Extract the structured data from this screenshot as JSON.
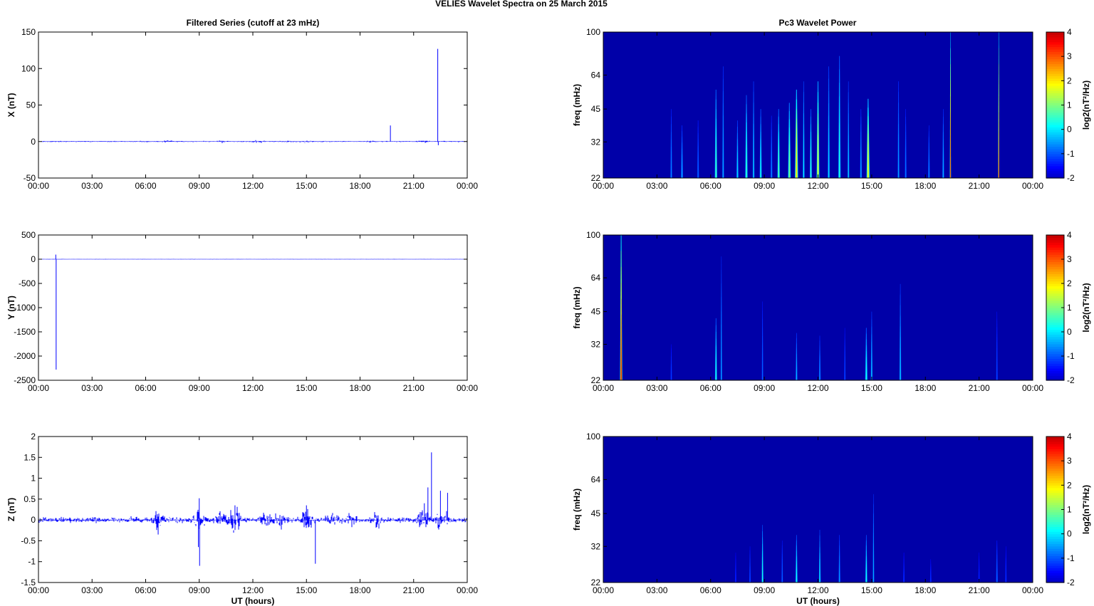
{
  "figure": {
    "suptitle": "VELIES Wavelet Spectra on 25 March     2015",
    "left_title": "Filtered Series (cutoff at 23 mHz)",
    "right_title": "Pc3 Wavelet Power"
  },
  "colors": {
    "series": "#0000ff",
    "axis": "#000000",
    "spec_bg": "#00008f"
  },
  "chart_data": [
    {
      "type": "line",
      "panel": "X",
      "ylabel": "X (nT)",
      "xlabel": "",
      "xticks": [
        "00:00",
        "03:00",
        "06:00",
        "09:00",
        "12:00",
        "15:00",
        "18:00",
        "21:00",
        "00:00"
      ],
      "xlim": [
        0,
        24
      ],
      "ylim": [
        -50,
        150
      ],
      "yticks": [
        -50,
        0,
        50,
        100,
        150
      ],
      "noise": 0.6,
      "bursts": [
        [
          4.0,
          0.3
        ],
        [
          7.2,
          0.6
        ],
        [
          10.2,
          0.8
        ],
        [
          12.3,
          1.0
        ],
        [
          14.0,
          0.7
        ],
        [
          15.0,
          0.8
        ],
        [
          18.5,
          0.6
        ],
        [
          21.6,
          0.9
        ]
      ],
      "spikes": [
        [
          19.7,
          22
        ],
        [
          22.35,
          127
        ],
        [
          22.38,
          -5
        ]
      ],
      "grid": false
    },
    {
      "type": "line",
      "panel": "Y",
      "ylabel": "Y (nT)",
      "xlabel": "",
      "xticks": [
        "00:00",
        "03:00",
        "06:00",
        "09:00",
        "12:00",
        "15:00",
        "18:00",
        "21:00",
        "00:00"
      ],
      "xlim": [
        0,
        24
      ],
      "ylim": [
        -2500,
        500
      ],
      "yticks": [
        -2500,
        -2000,
        -1500,
        -1000,
        -500,
        0,
        500
      ],
      "noise": 2,
      "bursts": [],
      "spikes": [
        [
          0.97,
          95
        ],
        [
          0.99,
          -2280
        ]
      ],
      "grid": false
    },
    {
      "type": "line",
      "panel": "Z",
      "ylabel": "Z (nT)",
      "xlabel": "UT (hours)",
      "xticks": [
        "00:00",
        "03:00",
        "06:00",
        "09:00",
        "12:00",
        "15:00",
        "18:00",
        "21:00",
        "00:00"
      ],
      "xlim": [
        0,
        24
      ],
      "ylim": [
        -1.5,
        2
      ],
      "yticks": [
        -1.5,
        -1,
        -0.5,
        0,
        0.5,
        1,
        1.5,
        2
      ],
      "yticklabels": [
        "-1.5",
        "-1",
        "-0.5",
        "0",
        "0.5",
        "1",
        "1.5",
        "2"
      ],
      "noise": 0.05,
      "bursts": [
        [
          6.7,
          0.13
        ],
        [
          9.0,
          0.2
        ],
        [
          10.2,
          0.15
        ],
        [
          11.0,
          0.25
        ],
        [
          12.8,
          0.15
        ],
        [
          13.6,
          0.13
        ],
        [
          15.0,
          0.22
        ],
        [
          16.5,
          0.12
        ],
        [
          17.5,
          0.1
        ],
        [
          19.0,
          0.12
        ],
        [
          21.5,
          0.2
        ],
        [
          22.6,
          0.2
        ]
      ],
      "spikes": [
        [
          9.0,
          0.52
        ],
        [
          9.02,
          -1.1
        ],
        [
          11.0,
          0.35
        ],
        [
          15.0,
          0.35
        ],
        [
          15.5,
          -1.05
        ],
        [
          21.6,
          0.4
        ],
        [
          21.8,
          0.78
        ],
        [
          22.0,
          1.62
        ],
        [
          22.5,
          0.7
        ],
        [
          22.9,
          0.65
        ],
        [
          8.95,
          -0.65
        ],
        [
          6.7,
          -0.35
        ]
      ],
      "grid": false
    },
    {
      "type": "heatmap",
      "panel": "X",
      "ylabel": "freq (mHz)",
      "xlabel": "",
      "colorbar_label": "log2(nT²/Hz)",
      "yscale": "log",
      "ylim": [
        22,
        100
      ],
      "yticks": [
        22,
        32,
        45,
        64,
        100
      ],
      "xlim": [
        0,
        24
      ],
      "xticks": [
        "00:00",
        "03:00",
        "06:00",
        "09:00",
        "12:00",
        "15:00",
        "18:00",
        "21:00",
        "00:00"
      ],
      "clim": [
        -2,
        4
      ],
      "cticks": [
        -2,
        -1,
        0,
        1,
        2,
        3,
        4
      ],
      "background_level": -2,
      "features": [
        [
          3.8,
          45,
          -0.8,
          0.05
        ],
        [
          4.4,
          38,
          -0.6,
          0.06
        ],
        [
          5.3,
          40,
          -1.0,
          0.05
        ],
        [
          6.3,
          55,
          0.6,
          0.07
        ],
        [
          6.7,
          70,
          -0.5,
          0.05
        ],
        [
          7.5,
          40,
          -0.2,
          0.06
        ],
        [
          8.0,
          52,
          0.5,
          0.07
        ],
        [
          8.4,
          60,
          -0.2,
          0.05
        ],
        [
          8.8,
          45,
          0.2,
          0.06
        ],
        [
          9.4,
          42,
          -0.8,
          0.05
        ],
        [
          9.8,
          45,
          0.7,
          0.07
        ],
        [
          10.4,
          48,
          1.0,
          0.08
        ],
        [
          10.8,
          55,
          2.2,
          0.09
        ],
        [
          11.2,
          60,
          0.0,
          0.05
        ],
        [
          11.6,
          45,
          0.5,
          0.06
        ],
        [
          12.0,
          60,
          1.8,
          0.08
        ],
        [
          12.6,
          70,
          -0.2,
          0.06
        ],
        [
          13.2,
          78,
          0.3,
          0.07
        ],
        [
          13.7,
          60,
          -0.3,
          0.05
        ],
        [
          14.4,
          45,
          -0.5,
          0.05
        ],
        [
          14.8,
          50,
          2.0,
          0.09
        ],
        [
          16.5,
          60,
          -0.6,
          0.05
        ],
        [
          16.9,
          45,
          -0.9,
          0.05
        ],
        [
          18.2,
          38,
          -0.8,
          0.05
        ],
        [
          19.0,
          45,
          -0.5,
          0.05
        ],
        [
          19.4,
          100,
          3.5,
          0.03
        ],
        [
          22.1,
          100,
          3.8,
          0.03
        ]
      ]
    },
    {
      "type": "heatmap",
      "panel": "Y",
      "ylabel": "freq (mHz)",
      "xlabel": "",
      "colorbar_label": "log2(nT²/Hz)",
      "yscale": "log",
      "ylim": [
        22,
        100
      ],
      "yticks": [
        22,
        32,
        45,
        64,
        100
      ],
      "xlim": [
        0,
        24
      ],
      "xticks": [
        "00:00",
        "03:00",
        "06:00",
        "09:00",
        "12:00",
        "15:00",
        "18:00",
        "21:00",
        "00:00"
      ],
      "clim": [
        -2,
        4
      ],
      "cticks": [
        -2,
        -1,
        0,
        1,
        2,
        3,
        4
      ],
      "background_level": -2,
      "features": [
        [
          1.0,
          100,
          4.0,
          0.06
        ],
        [
          3.8,
          32,
          -1.3,
          0.04
        ],
        [
          6.3,
          42,
          0.3,
          0.06
        ],
        [
          6.6,
          80,
          -0.5,
          0.04
        ],
        [
          8.9,
          50,
          -1.0,
          0.04
        ],
        [
          10.8,
          36,
          -0.4,
          0.05
        ],
        [
          12.1,
          35,
          -0.7,
          0.05
        ],
        [
          13.5,
          38,
          -1.2,
          0.04
        ],
        [
          14.7,
          38,
          0.2,
          0.07
        ],
        [
          15.0,
          45,
          -0.3,
          0.05
        ],
        [
          16.6,
          60,
          -0.3,
          0.05
        ],
        [
          22.0,
          45,
          -1.2,
          0.04
        ]
      ]
    },
    {
      "type": "heatmap",
      "panel": "Z",
      "ylabel": "freq (mHz)",
      "xlabel": "UT (hours)",
      "colorbar_label": "log2(nT²/Hz)",
      "yscale": "log",
      "ylim": [
        22,
        100
      ],
      "yticks": [
        22,
        32,
        45,
        64,
        100
      ],
      "xlim": [
        0,
        24
      ],
      "xticks": [
        "00:00",
        "03:00",
        "06:00",
        "09:00",
        "12:00",
        "15:00",
        "18:00",
        "21:00",
        "00:00"
      ],
      "clim": [
        -2,
        4
      ],
      "cticks": [
        -2,
        -1,
        0,
        1,
        2,
        3,
        4
      ],
      "background_level": -2,
      "features": [
        [
          7.4,
          30,
          -1.5,
          0.04
        ],
        [
          8.2,
          32,
          -1.2,
          0.04
        ],
        [
          8.9,
          40,
          0.3,
          0.05
        ],
        [
          10.0,
          34,
          -1.0,
          0.04
        ],
        [
          10.8,
          36,
          0.2,
          0.06
        ],
        [
          12.1,
          38,
          0.0,
          0.05
        ],
        [
          13.2,
          36,
          -0.6,
          0.05
        ],
        [
          14.7,
          36,
          0.2,
          0.06
        ],
        [
          15.1,
          55,
          -0.4,
          0.04
        ],
        [
          16.8,
          30,
          -1.4,
          0.04
        ],
        [
          18.3,
          28,
          -1.4,
          0.04
        ],
        [
          21.0,
          30,
          -1.5,
          0.04
        ],
        [
          22.0,
          34,
          -1.0,
          0.05
        ],
        [
          22.5,
          32,
          -1.4,
          0.04
        ]
      ]
    }
  ]
}
